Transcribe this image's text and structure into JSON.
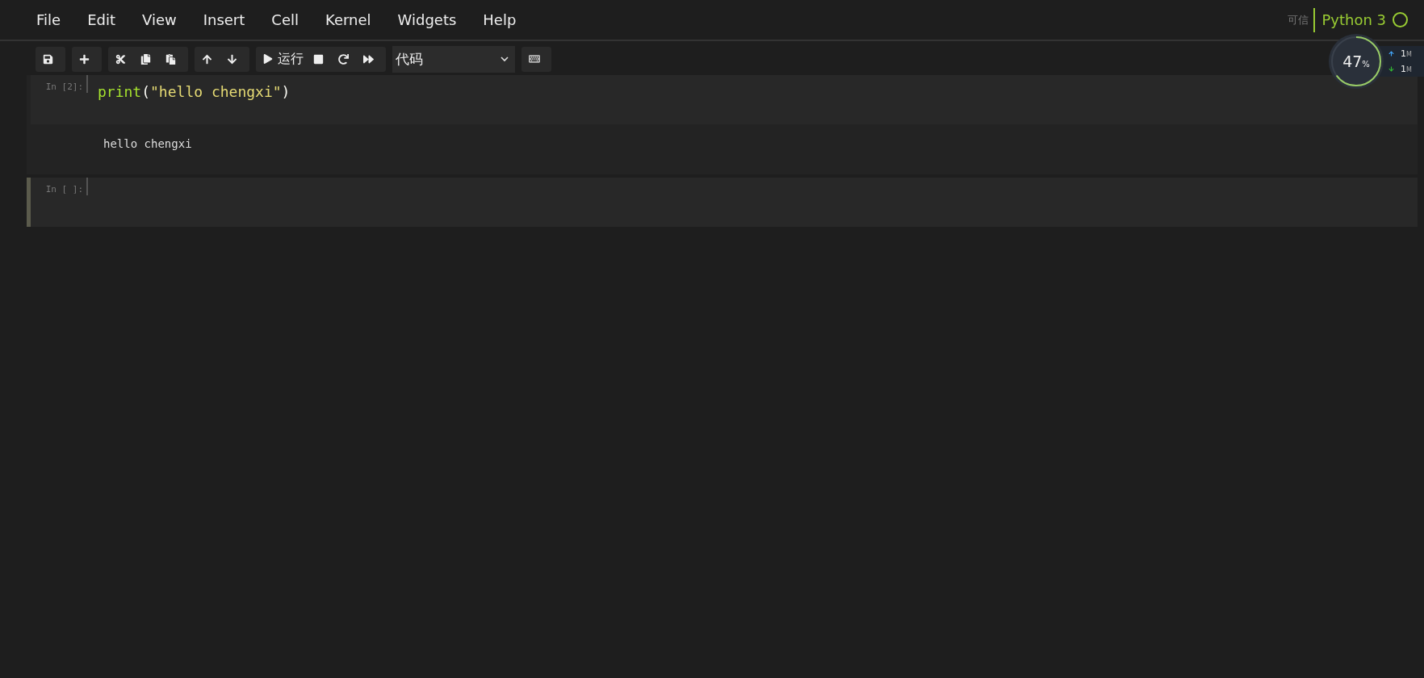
{
  "menu": [
    "File",
    "Edit",
    "View",
    "Insert",
    "Cell",
    "Kernel",
    "Widgets",
    "Help"
  ],
  "kernel": {
    "trust": "可信",
    "name": "Python 3",
    "busy": false
  },
  "toolbar": {
    "groups": [
      [
        {
          "kind": "save"
        }
      ],
      [
        {
          "kind": "add"
        }
      ],
      [
        {
          "kind": "cut"
        },
        {
          "kind": "copy"
        },
        {
          "kind": "paste"
        }
      ],
      [
        {
          "kind": "up"
        },
        {
          "kind": "down"
        }
      ],
      [
        {
          "kind": "run",
          "label": "运行"
        },
        {
          "kind": "stop"
        },
        {
          "kind": "restart"
        },
        {
          "kind": "runall"
        }
      ]
    ],
    "cell_type": "代码"
  },
  "cells": [
    {
      "prompt": "In [2]:",
      "code": [
        {
          "kind": "builtin",
          "text": "print"
        },
        {
          "kind": "paren",
          "text": "("
        },
        {
          "kind": "string",
          "text": "\"hello chengxi\""
        },
        {
          "kind": "paren",
          "text": ")"
        }
      ],
      "output": "hello chengxi",
      "selected": false
    },
    {
      "prompt": "In [ ]:",
      "selected": true
    }
  ],
  "monitor": {
    "percent": "47",
    "unit": "%",
    "rates": [
      {
        "kind": "up",
        "value": "1",
        "unit": "M"
      },
      {
        "kind": "down",
        "value": "1",
        "unit": "M"
      }
    ]
  }
}
